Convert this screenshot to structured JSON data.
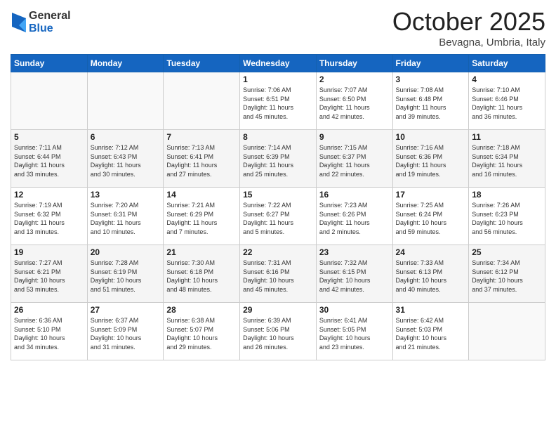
{
  "header": {
    "logo": {
      "general": "General",
      "blue": "Blue"
    },
    "title": "October 2025",
    "subtitle": "Bevagna, Umbria, Italy"
  },
  "calendar": {
    "weekdays": [
      "Sunday",
      "Monday",
      "Tuesday",
      "Wednesday",
      "Thursday",
      "Friday",
      "Saturday"
    ],
    "weeks": [
      [
        {
          "day": "",
          "info": ""
        },
        {
          "day": "",
          "info": ""
        },
        {
          "day": "",
          "info": ""
        },
        {
          "day": "1",
          "info": "Sunrise: 7:06 AM\nSunset: 6:51 PM\nDaylight: 11 hours\nand 45 minutes."
        },
        {
          "day": "2",
          "info": "Sunrise: 7:07 AM\nSunset: 6:50 PM\nDaylight: 11 hours\nand 42 minutes."
        },
        {
          "day": "3",
          "info": "Sunrise: 7:08 AM\nSunset: 6:48 PM\nDaylight: 11 hours\nand 39 minutes."
        },
        {
          "day": "4",
          "info": "Sunrise: 7:10 AM\nSunset: 6:46 PM\nDaylight: 11 hours\nand 36 minutes."
        }
      ],
      [
        {
          "day": "5",
          "info": "Sunrise: 7:11 AM\nSunset: 6:44 PM\nDaylight: 11 hours\nand 33 minutes."
        },
        {
          "day": "6",
          "info": "Sunrise: 7:12 AM\nSunset: 6:43 PM\nDaylight: 11 hours\nand 30 minutes."
        },
        {
          "day": "7",
          "info": "Sunrise: 7:13 AM\nSunset: 6:41 PM\nDaylight: 11 hours\nand 27 minutes."
        },
        {
          "day": "8",
          "info": "Sunrise: 7:14 AM\nSunset: 6:39 PM\nDaylight: 11 hours\nand 25 minutes."
        },
        {
          "day": "9",
          "info": "Sunrise: 7:15 AM\nSunset: 6:37 PM\nDaylight: 11 hours\nand 22 minutes."
        },
        {
          "day": "10",
          "info": "Sunrise: 7:16 AM\nSunset: 6:36 PM\nDaylight: 11 hours\nand 19 minutes."
        },
        {
          "day": "11",
          "info": "Sunrise: 7:18 AM\nSunset: 6:34 PM\nDaylight: 11 hours\nand 16 minutes."
        }
      ],
      [
        {
          "day": "12",
          "info": "Sunrise: 7:19 AM\nSunset: 6:32 PM\nDaylight: 11 hours\nand 13 minutes."
        },
        {
          "day": "13",
          "info": "Sunrise: 7:20 AM\nSunset: 6:31 PM\nDaylight: 11 hours\nand 10 minutes."
        },
        {
          "day": "14",
          "info": "Sunrise: 7:21 AM\nSunset: 6:29 PM\nDaylight: 11 hours\nand 7 minutes."
        },
        {
          "day": "15",
          "info": "Sunrise: 7:22 AM\nSunset: 6:27 PM\nDaylight: 11 hours\nand 5 minutes."
        },
        {
          "day": "16",
          "info": "Sunrise: 7:23 AM\nSunset: 6:26 PM\nDaylight: 11 hours\nand 2 minutes."
        },
        {
          "day": "17",
          "info": "Sunrise: 7:25 AM\nSunset: 6:24 PM\nDaylight: 10 hours\nand 59 minutes."
        },
        {
          "day": "18",
          "info": "Sunrise: 7:26 AM\nSunset: 6:23 PM\nDaylight: 10 hours\nand 56 minutes."
        }
      ],
      [
        {
          "day": "19",
          "info": "Sunrise: 7:27 AM\nSunset: 6:21 PM\nDaylight: 10 hours\nand 53 minutes."
        },
        {
          "day": "20",
          "info": "Sunrise: 7:28 AM\nSunset: 6:19 PM\nDaylight: 10 hours\nand 51 minutes."
        },
        {
          "day": "21",
          "info": "Sunrise: 7:30 AM\nSunset: 6:18 PM\nDaylight: 10 hours\nand 48 minutes."
        },
        {
          "day": "22",
          "info": "Sunrise: 7:31 AM\nSunset: 6:16 PM\nDaylight: 10 hours\nand 45 minutes."
        },
        {
          "day": "23",
          "info": "Sunrise: 7:32 AM\nSunset: 6:15 PM\nDaylight: 10 hours\nand 42 minutes."
        },
        {
          "day": "24",
          "info": "Sunrise: 7:33 AM\nSunset: 6:13 PM\nDaylight: 10 hours\nand 40 minutes."
        },
        {
          "day": "25",
          "info": "Sunrise: 7:34 AM\nSunset: 6:12 PM\nDaylight: 10 hours\nand 37 minutes."
        }
      ],
      [
        {
          "day": "26",
          "info": "Sunrise: 6:36 AM\nSunset: 5:10 PM\nDaylight: 10 hours\nand 34 minutes."
        },
        {
          "day": "27",
          "info": "Sunrise: 6:37 AM\nSunset: 5:09 PM\nDaylight: 10 hours\nand 31 minutes."
        },
        {
          "day": "28",
          "info": "Sunrise: 6:38 AM\nSunset: 5:07 PM\nDaylight: 10 hours\nand 29 minutes."
        },
        {
          "day": "29",
          "info": "Sunrise: 6:39 AM\nSunset: 5:06 PM\nDaylight: 10 hours\nand 26 minutes."
        },
        {
          "day": "30",
          "info": "Sunrise: 6:41 AM\nSunset: 5:05 PM\nDaylight: 10 hours\nand 23 minutes."
        },
        {
          "day": "31",
          "info": "Sunrise: 6:42 AM\nSunset: 5:03 PM\nDaylight: 10 hours\nand 21 minutes."
        },
        {
          "day": "",
          "info": ""
        }
      ]
    ]
  }
}
